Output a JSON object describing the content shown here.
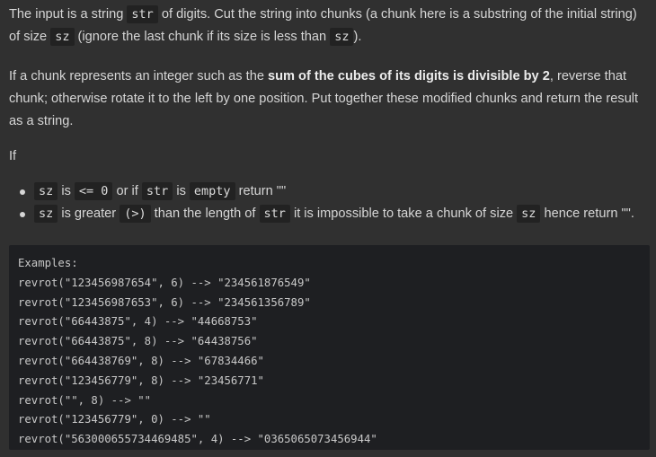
{
  "intro": {
    "t1": "The input is a string ",
    "c1": "str",
    "t2": " of digits. Cut the string into chunks (a chunk here is a substring of the initial string) of size ",
    "c2": "sz",
    "t3": " (ignore the last chunk if its size is less than ",
    "c3": "sz",
    "t4": ")."
  },
  "rule": {
    "t1": "If a chunk represents an integer such as the ",
    "bold": "sum of the cubes of its digits is divisible by 2",
    "t2": ", reverse that chunk; otherwise rotate it to the left by one position. Put together these modified chunks and return the result as a string."
  },
  "if_label": "If",
  "bullets": {
    "b1": {
      "c1": "sz",
      "t1": " is ",
      "c2": "<= 0",
      "t2": " or if ",
      "c3": "str",
      "t3": " is ",
      "c4": "empty",
      "t4": " return \"\""
    },
    "b2": {
      "c1": "sz",
      "t1": " is greater ",
      "c2": "(>)",
      "t2": " than the length of ",
      "c3": "str",
      "t3": " it is impossible to take a chunk of size ",
      "c4": "sz",
      "t4": " hence return \"\"."
    }
  },
  "examples": {
    "header": "Examples:",
    "lines": [
      "revrot(\"123456987654\", 6) --> \"234561876549\"",
      "revrot(\"123456987653\", 6) --> \"234561356789\"",
      "revrot(\"66443875\", 4) --> \"44668753\"",
      "revrot(\"66443875\", 8) --> \"64438756\"",
      "revrot(\"664438769\", 8) --> \"67834466\"",
      "revrot(\"123456779\", 8) --> \"23456771\"",
      "revrot(\"\", 8) --> \"\"",
      "revrot(\"123456779\", 0) --> \"\"",
      "revrot(\"563000655734469485\", 4) --> \"0365065073456944\""
    ]
  }
}
